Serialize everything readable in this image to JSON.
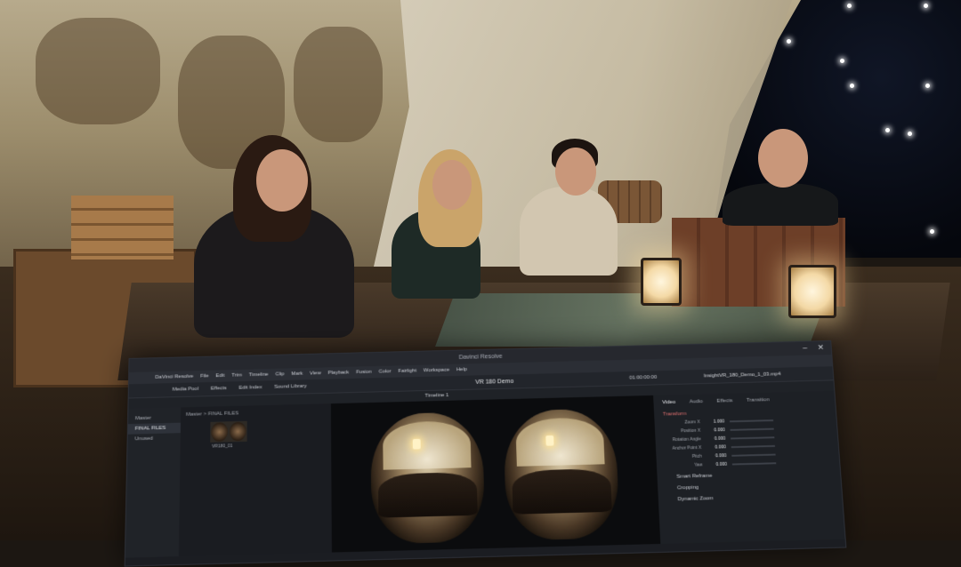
{
  "window": {
    "title": "Davinci Resolve"
  },
  "menu_items": [
    "DaVinci Resolve",
    "File",
    "Edit",
    "Trim",
    "Timeline",
    "Clip",
    "Mark",
    "View",
    "Playback",
    "Fusion",
    "Color",
    "Fairlight",
    "Workspace",
    "Help"
  ],
  "toolbar": {
    "items": [
      "Media Pool",
      "Effects",
      "Edit Index",
      "Sound Library"
    ],
    "project_name": "VR 180 Demo",
    "timeline_name": "Timeline 1",
    "timecode": "01:00:00:00",
    "clip_name": "InsightVR_180_Demo_1_03.mp4"
  },
  "bins": {
    "items": [
      "Master",
      "FINAL FILES",
      "Unused"
    ],
    "selected": "FINAL FILES"
  },
  "media_pool": {
    "path": "Master > FINAL FILES",
    "thumb_name": "VR180_01"
  },
  "inspector": {
    "tabs": [
      "Video",
      "Audio",
      "Effects",
      "Transition"
    ],
    "active_tab": "Video",
    "section": "Transform",
    "rows": [
      {
        "label": "Zoom X",
        "value": "1.000"
      },
      {
        "label": "Position X",
        "value": "0.000"
      },
      {
        "label": "Rotation Angle",
        "value": "0.000"
      },
      {
        "label": "Anchor Point X",
        "value": "0.000"
      },
      {
        "label": "Pitch",
        "value": "0.000"
      },
      {
        "label": "Yaw",
        "value": "0.000"
      }
    ],
    "sections": [
      "Smart Reframe",
      "Cropping",
      "Dynamic Zoom"
    ]
  }
}
